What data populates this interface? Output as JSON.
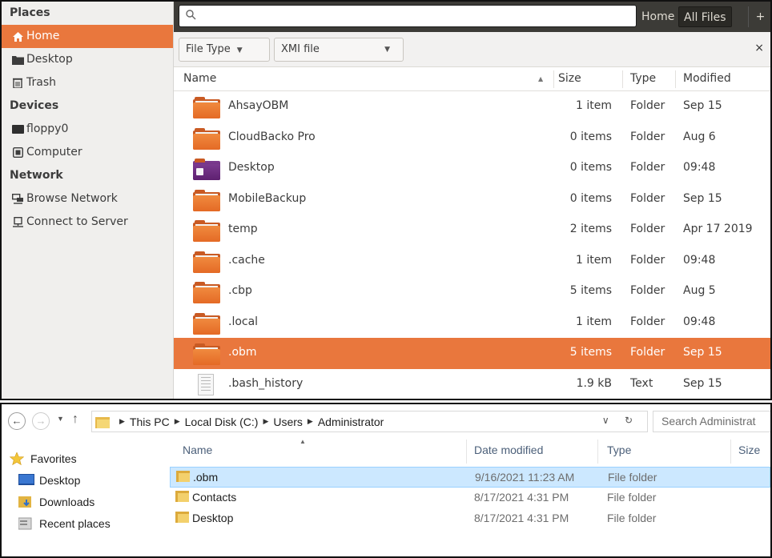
{
  "gtk": {
    "sidebar": {
      "places_heading": "Places",
      "places": [
        {
          "label": "Home",
          "icon": "home-icon",
          "active": true
        },
        {
          "label": "Desktop",
          "icon": "desktop-folder-icon"
        },
        {
          "label": "Trash",
          "icon": "trash-icon"
        }
      ],
      "devices_heading": "Devices",
      "devices": [
        {
          "label": "floppy0",
          "icon": "drive-icon"
        },
        {
          "label": "Computer",
          "icon": "computer-icon"
        }
      ],
      "network_heading": "Network",
      "network": [
        {
          "label": "Browse Network",
          "icon": "network-icon"
        },
        {
          "label": "Connect to Server",
          "icon": "server-icon"
        }
      ]
    },
    "search": {
      "placeholder": ""
    },
    "tabs": {
      "home": "Home",
      "all_files": "All Files",
      "plus": "+"
    },
    "filter": {
      "type_label": "File Type",
      "type_value": "XMI file",
      "close": "×"
    },
    "columns": {
      "name": "Name",
      "sort": "▲",
      "size": "Size",
      "type": "Type",
      "modified": "Modified"
    },
    "rows": [
      {
        "name": "AhsayOBM",
        "size": "1 item",
        "type": "Folder",
        "modified": "Sep 15",
        "icon": "folder"
      },
      {
        "name": "CloudBacko Pro",
        "size": "0 items",
        "type": "Folder",
        "modified": "Aug 6",
        "icon": "folder"
      },
      {
        "name": "Desktop",
        "size": "0 items",
        "type": "Folder",
        "modified": "09:48",
        "icon": "desktop"
      },
      {
        "name": "MobileBackup",
        "size": "0 items",
        "type": "Folder",
        "modified": "Sep 15",
        "icon": "folder"
      },
      {
        "name": "temp",
        "size": "2 items",
        "type": "Folder",
        "modified": "Apr 17 2019",
        "icon": "folder"
      },
      {
        "name": ".cache",
        "size": "1 item",
        "type": "Folder",
        "modified": "09:48",
        "icon": "folder"
      },
      {
        "name": ".cbp",
        "size": "5 items",
        "type": "Folder",
        "modified": "Aug 5",
        "icon": "folder"
      },
      {
        "name": ".local",
        "size": "1 item",
        "type": "Folder",
        "modified": "09:48",
        "icon": "folder"
      },
      {
        "name": ".obm",
        "size": "5 items",
        "type": "Folder",
        "modified": "Sep 15",
        "icon": "folder",
        "selected": true
      },
      {
        "name": ".bash_history",
        "size": "1.9 kB",
        "type": "Text",
        "modified": "Sep 15",
        "icon": "text"
      }
    ],
    "colors": {
      "accent": "#e9773d",
      "topbar": "#3c3b37",
      "sidebar": "#f0efed"
    }
  },
  "win": {
    "breadcrumbs": [
      "This PC",
      "Local Disk (C:)",
      "Users",
      "Administrator"
    ],
    "search_placeholder": "Search Administrat",
    "nav": {
      "favorites": "Favorites",
      "items": [
        "Desktop",
        "Downloads",
        "Recent places"
      ]
    },
    "columns": {
      "name": "Name",
      "date": "Date modified",
      "type": "Type",
      "size": "Size"
    },
    "rows": [
      {
        "name": ".obm",
        "date": "9/16/2021 11:23 AM",
        "type": "File folder",
        "selected": true
      },
      {
        "name": "Contacts",
        "date": "8/17/2021 4:31 PM",
        "type": "File folder"
      },
      {
        "name": "Desktop",
        "date": "8/17/2021 4:31 PM",
        "type": "File folder"
      }
    ],
    "colors": {
      "selection": "#cce8ff",
      "header_text": "#4c607a"
    }
  }
}
